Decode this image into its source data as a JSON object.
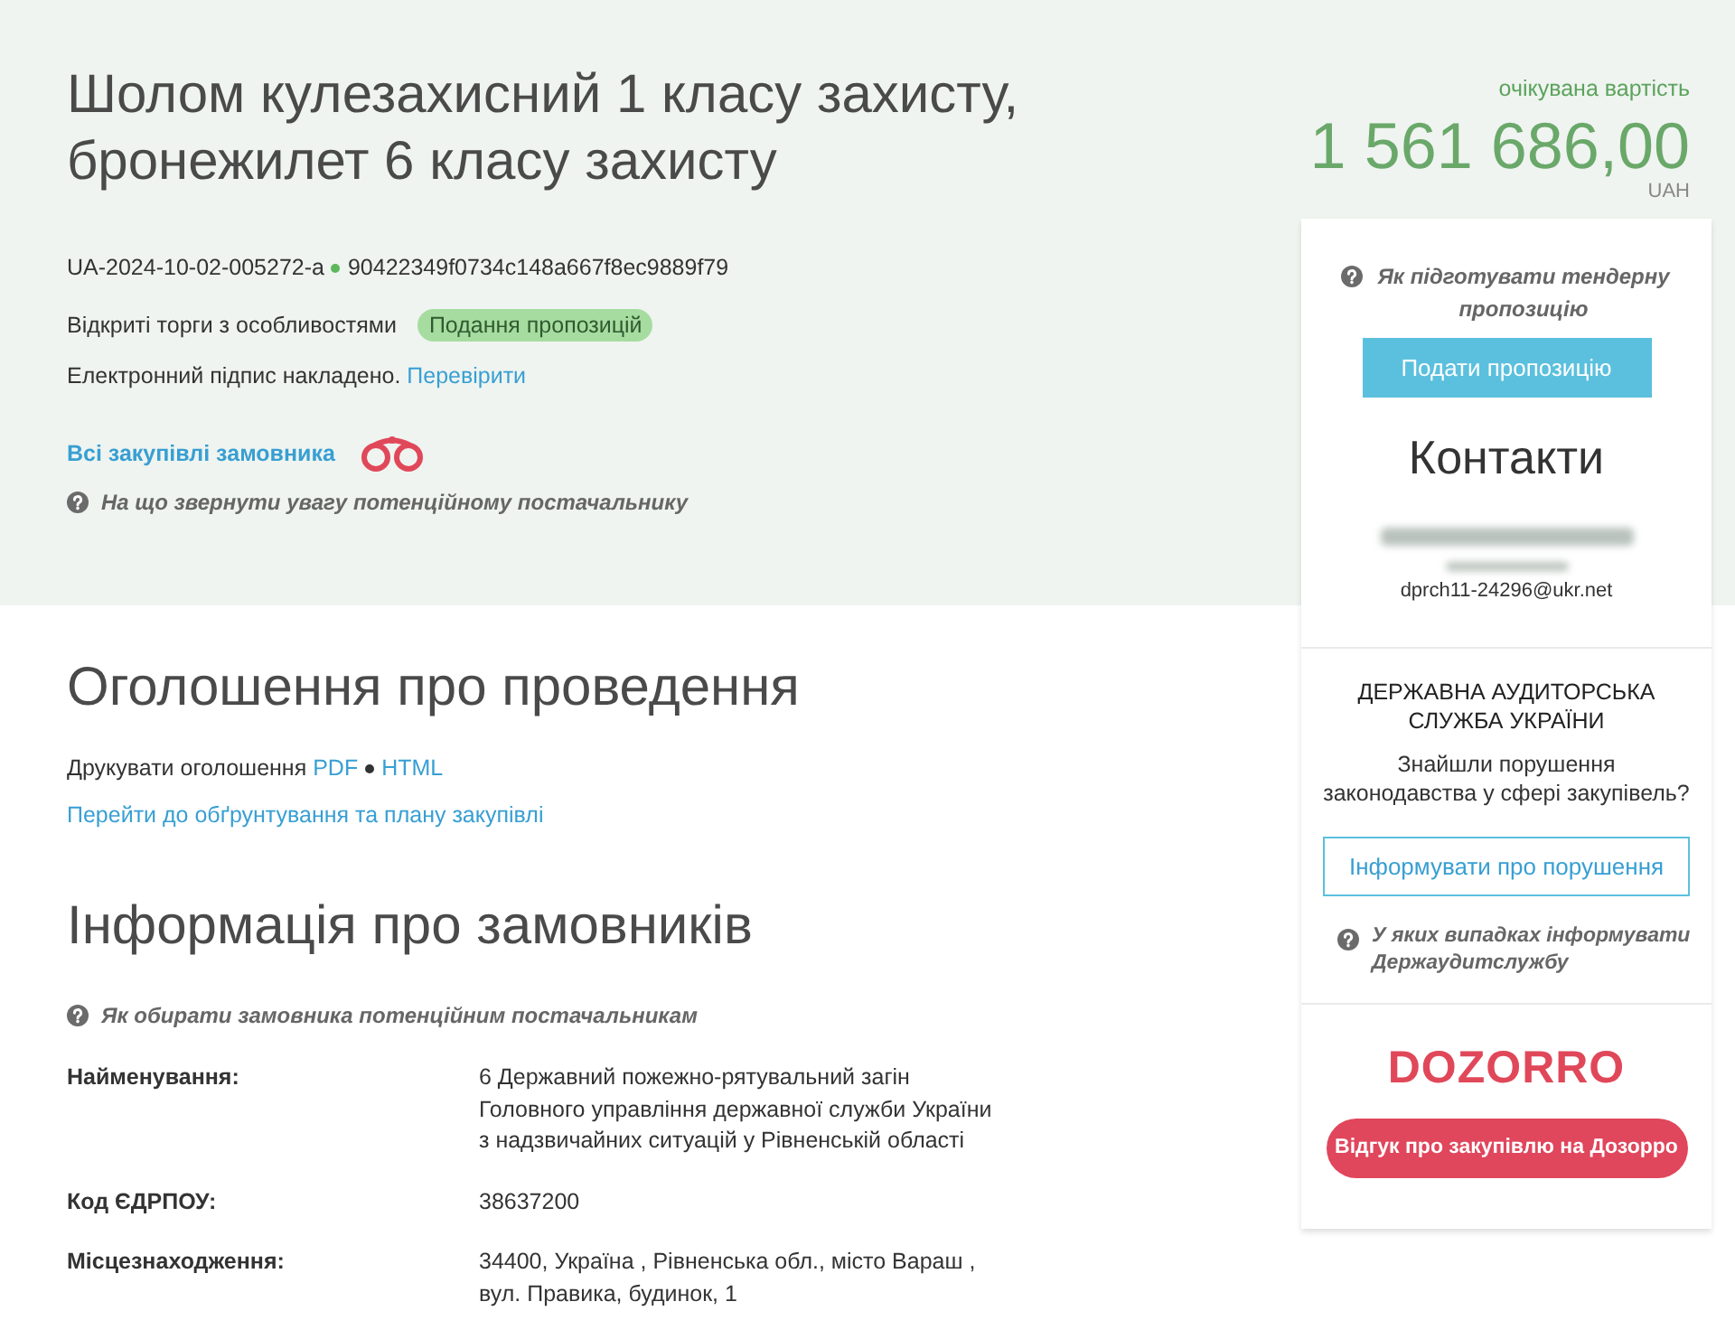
{
  "header": {
    "title": "Шолом кулезахисний 1 класу захисту, бронежилет 6 класу захисту",
    "tender_id": "UA-2024-10-02-005272-a",
    "hash": "90422349f0734c148a667f8ec9889f79",
    "procedure_type": "Відкриті торги з особливостями",
    "status": "Подання пропозицій",
    "signature_text": "Електронний підпис накладено.",
    "signature_link": "Перевірити",
    "customer_tenders_link": "Всі закупівлі замовника",
    "help_link": "На що звернути увагу потенційному постачальнику"
  },
  "budget": {
    "label": "очікувана вартість",
    "amount": "1 561 686,00",
    "currency": "UAH"
  },
  "announcement": {
    "title": "Оголошення про проведення",
    "print_label": "Друкувати оголошення",
    "print_formats": [
      "PDF",
      "HTML"
    ],
    "plan_link": "Перейти до обґрунтування та плану закупівлі"
  },
  "customer_info": {
    "title": "Інформація про замовників",
    "help_link": "Як обирати замовника потенційним постачальникам",
    "fields": [
      {
        "label": "Найменування:",
        "value": "6 Державний пожежно-рятувальний загін Головного управління державної служби України з надзвичайних ситуацій у Рівненській області"
      },
      {
        "label": "Код ЄДРПОУ:",
        "value": "38637200"
      },
      {
        "label": "Місцезнаходження:",
        "value": "34400, Україна , Рівненська обл., місто Вараш , вул. Правика, будинок, 1"
      }
    ]
  },
  "sidebar": {
    "help_link": "Як підготувати тендерну пропозицію",
    "submit_button": "Подати пропозицію",
    "contacts_title": "Контакти",
    "contact_email": "dprch11-24296@ukr.net",
    "auditor": {
      "title": "ДЕРЖАВНА АУДИТОРСЬКА СЛУЖБА УКРАЇНИ",
      "question": "Знайшли порушення законодавства у сфері закупівель?",
      "button": "Інформувати про порушення",
      "help_link": "У яких випадках інформувати Держаудитслужбу"
    },
    "dozorro": {
      "logo": "DOZORRO",
      "button": "Відгук про закупівлю на Дозорро"
    }
  }
}
